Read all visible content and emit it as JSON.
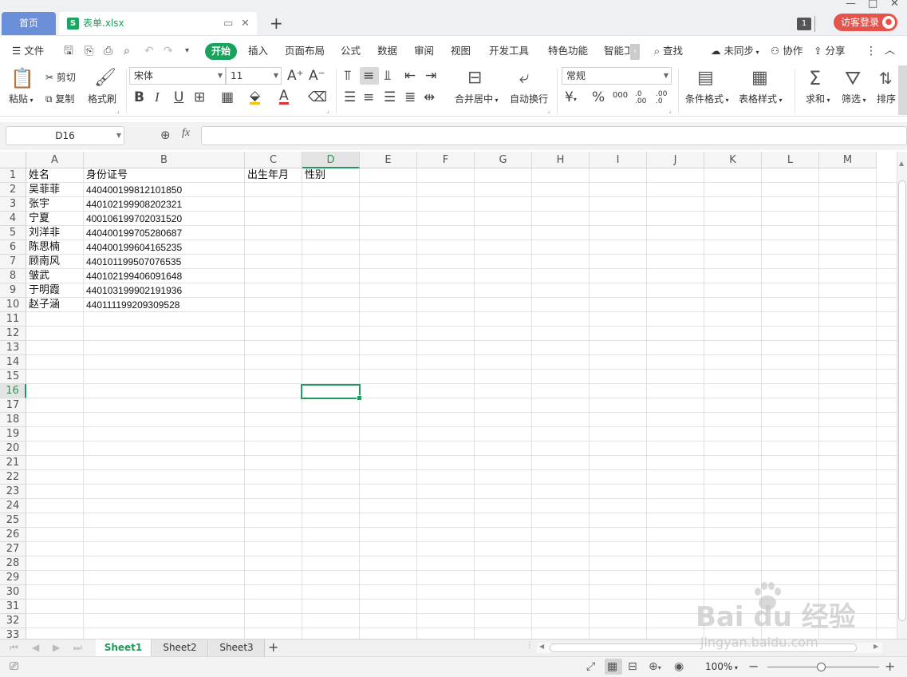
{
  "title_bar": {
    "home_tab": "首页",
    "file_tab": "表单.xlsx",
    "file_icon_letter": "S",
    "new_tab": "+",
    "window_count": "1",
    "login_button": "访客登录"
  },
  "menu": {
    "file": "文件",
    "tabs": [
      "开始",
      "插入",
      "页面布局",
      "公式",
      "数据",
      "审阅",
      "视图",
      "开发工具",
      "特色功能",
      "智能工"
    ],
    "search": "查找",
    "sync": "未同步",
    "collaborate": "协作",
    "share": "分享"
  },
  "ribbon": {
    "paste": "粘贴",
    "cut": "剪切",
    "copy": "复制",
    "format_painter": "格式刷",
    "font_name": "宋体",
    "font_size": "11",
    "bold": "B",
    "italic": "I",
    "underline": "U",
    "merge_center": "合并居中",
    "wrap_text": "自动换行",
    "number_format": "常规",
    "percent": "%",
    "thousands": "000",
    "inc_decimal": ".0 .00",
    "dec_decimal": ".00 .0",
    "conditional_format": "条件格式",
    "table_style": "表格样式",
    "sum": "求和",
    "filter": "筛选",
    "sort": "排序"
  },
  "formula_bar": {
    "name_box": "D16",
    "fx": "fx",
    "formula": ""
  },
  "sheet": {
    "columns": [
      "A",
      "B",
      "C",
      "D",
      "E",
      "F",
      "G",
      "H",
      "I",
      "J",
      "K",
      "L",
      "M"
    ],
    "rows": [
      "1",
      "2",
      "3",
      "4",
      "5",
      "6",
      "7",
      "8",
      "9",
      "10",
      "11",
      "12",
      "13",
      "14",
      "15",
      "16",
      "17",
      "18",
      "19",
      "20",
      "21",
      "22",
      "23",
      "24",
      "25",
      "26",
      "27",
      "28",
      "29",
      "30",
      "31",
      "32",
      "33"
    ],
    "active_cell": "D16",
    "cells": {
      "A1": "姓名",
      "B1": "身份证号",
      "C1": "出生年月",
      "D1": "性别",
      "A2": "吴菲菲",
      "B2": "440400199812101850",
      "A3": "张宇",
      "B3": "440102199908202321",
      "A4": "宁夏",
      "B4": "400106199702031520",
      "A5": "刘洋非",
      "B5": "440400199705280687",
      "A6": "陈思楠",
      "B6": "440400199604165235",
      "A7": "顾南风",
      "B7": "440101199507076535",
      "A8": "皱武",
      "B8": "440102199406091648",
      "A9": "于明霞",
      "B9": "440103199902191936",
      "A10": "赵子涵",
      "B10": "440111199209309528"
    }
  },
  "sheet_tabs": [
    "Sheet1",
    "Sheet2",
    "Sheet3"
  ],
  "active_sheet": "Sheet1",
  "status_bar": {
    "zoom": "100%"
  },
  "watermark": {
    "brand": "Bai du 经验",
    "url": "jingyan.baidu.com"
  },
  "colors": {
    "accent": "#1aa35c",
    "home_tab": "#6a8fd8",
    "login": "#e5534b"
  }
}
